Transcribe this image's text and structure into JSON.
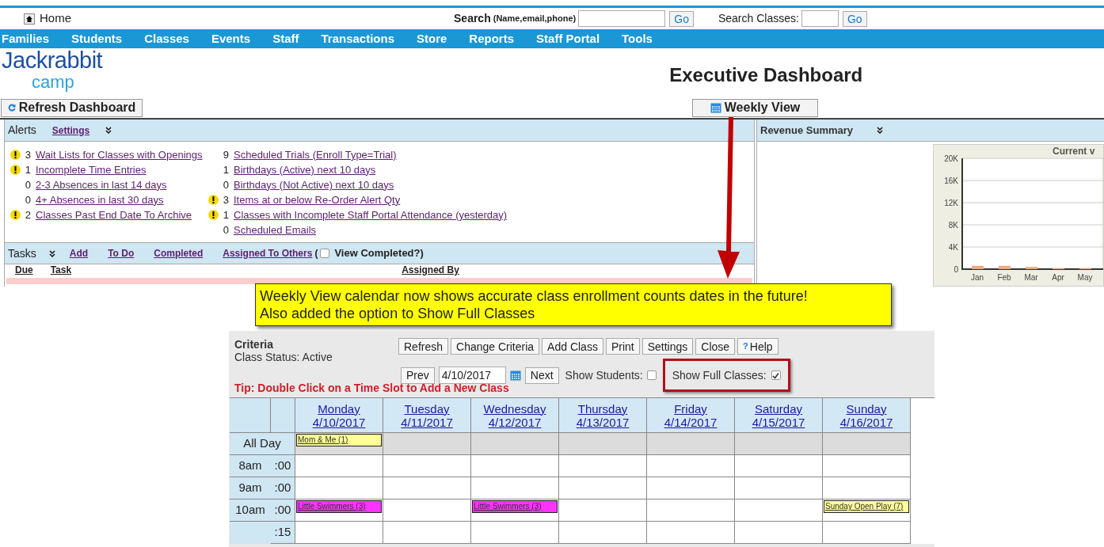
{
  "top_bar": {
    "home_link": "Home",
    "search": {
      "label": "Search",
      "hint": "(Name,email,phone)",
      "button": "Go"
    },
    "class_search": {
      "label": "Search Classes:",
      "button": "Go"
    }
  },
  "nav": [
    "Families",
    "Students",
    "Classes",
    "Events",
    "Staff",
    "Transactions",
    "Store",
    "Reports",
    "Staff Portal",
    "Tools"
  ],
  "logo": {
    "line_1": "Jackrabbit",
    "line_2": "camp"
  },
  "title": "Executive Dashboard",
  "refresh_button": "Refresh Dashboard",
  "weekly_view_button": "Weekly View",
  "alerts": {
    "title": "Alerts",
    "settings_link": "Settings",
    "left": [
      {
        "warning": true,
        "count": "3",
        "label": "Wait Lists for Classes with Openings"
      },
      {
        "warning": true,
        "count": "1",
        "label": "Incomplete Time Entries"
      },
      {
        "warning": false,
        "count": "0",
        "label": "2-3 Absences in last 14 days"
      },
      {
        "warning": false,
        "count": "0",
        "label": "4+ Absences in last 30 days"
      },
      {
        "warning": true,
        "count": "2",
        "label": "Classes Past End Date To Archive"
      }
    ],
    "right": [
      {
        "warning": false,
        "count": "9",
        "label": "Scheduled Trials (Enroll Type=Trial)"
      },
      {
        "warning": false,
        "count": "1",
        "label": "Birthdays (Active) next 10 days"
      },
      {
        "warning": false,
        "count": "0",
        "label": "Birthdays (Not Active) next 10 days"
      },
      {
        "warning": true,
        "count": "3",
        "label": "Items at or below Re-Order Alert Qty"
      },
      {
        "warning": true,
        "count": "1",
        "label": "Classes with Incomplete Staff Portal Attendance (yesterday)"
      },
      {
        "warning": false,
        "count": "0",
        "label": "Scheduled Emails"
      }
    ]
  },
  "tasks": {
    "title": "Tasks",
    "links": [
      "Add",
      "To Do",
      "Completed",
      "Assigned To Others"
    ],
    "open_paren": "(",
    "view_completed": {
      "label": "View Completed?)",
      "checked": false
    },
    "columns": [
      "Due",
      "Task",
      "Assigned By"
    ]
  },
  "revenue": {
    "title": "Revenue Summary",
    "chart_data": {
      "type": "bar",
      "grid": true,
      "title": "Current v",
      "categories": [
        "Jan",
        "Feb",
        "Mar",
        "Apr",
        "May"
      ],
      "values": [
        600,
        600,
        400,
        200,
        200
      ],
      "ylim": [
        0,
        20000
      ],
      "yticks": [
        {
          "value": 0,
          "label": "0"
        },
        {
          "value": 4000,
          "label": "4K"
        },
        {
          "value": 8000,
          "label": "8K"
        },
        {
          "value": 12000,
          "label": "12K"
        },
        {
          "value": 16000,
          "label": "16K"
        },
        {
          "value": 20000,
          "label": "20K"
        }
      ]
    }
  },
  "callout": {
    "lines": [
      "Weekly View calendar now shows accurate class enrollment counts dates in the future!",
      "Also added the option to Show Full Classes"
    ]
  },
  "weekly": {
    "criteria_title": "Criteria",
    "class_status": "Class Status: Active",
    "buttons": [
      {
        "kind": "plain",
        "label": "Refresh"
      },
      {
        "kind": "plain",
        "label": "Change Criteria"
      },
      {
        "kind": "plain",
        "label": "Add Class"
      },
      {
        "kind": "plain",
        "label": "Print"
      },
      {
        "kind": "plain",
        "label": "Settings"
      },
      {
        "kind": "plain",
        "label": "Close"
      },
      {
        "kind": "help",
        "icon": "?",
        "label": "Help"
      }
    ],
    "prev": "Prev",
    "date": "4/10/2017",
    "next": "Next",
    "show_students": {
      "label": "Show Students:",
      "checked": false
    },
    "show_full_classes": {
      "label": "Show Full Classes:",
      "checked": true,
      "highlighted": true
    },
    "tip": "Tip: Double Click on a Time Slot to Add a New Class",
    "days": [
      {
        "name": "Monday",
        "date": "4/10/2017"
      },
      {
        "name": "Tuesday",
        "date": "4/11/2017"
      },
      {
        "name": "Wednesday",
        "date": "4/12/2017"
      },
      {
        "name": "Thursday",
        "date": "4/13/2017"
      },
      {
        "name": "Friday",
        "date": "4/14/2017"
      },
      {
        "name": "Saturday",
        "date": "4/15/2017"
      },
      {
        "name": "Sunday",
        "date": "4/16/2017"
      }
    ],
    "rows": [
      {
        "kind": "allday",
        "label": "All Day",
        "cells": [
          {
            "label": "Mom & Me (1)",
            "color": "#ffff99"
          },
          null,
          null,
          null,
          null,
          null,
          null
        ]
      },
      {
        "kind": "slot",
        "hour": "8am",
        "minute": ":00",
        "cells": [
          null,
          null,
          null,
          null,
          null,
          null,
          null
        ]
      },
      {
        "kind": "slot",
        "hour": "9am",
        "minute": ":00",
        "cells": [
          null,
          null,
          null,
          null,
          null,
          null,
          null
        ]
      },
      {
        "kind": "slot",
        "hour": "10am",
        "minute": ":00",
        "cells": [
          {
            "label": "Little Swimmers (3)",
            "color": "#ff33ff"
          },
          null,
          {
            "label": "Little Swimmers (3)",
            "color": "#ff33ff"
          },
          null,
          null,
          null,
          {
            "label": "Sunday Open Play (7)",
            "color": "#ffff99"
          }
        ]
      },
      {
        "kind": "slot",
        "minute": ":15",
        "cells": [
          null,
          null,
          null,
          null,
          null,
          null,
          null
        ]
      }
    ]
  }
}
